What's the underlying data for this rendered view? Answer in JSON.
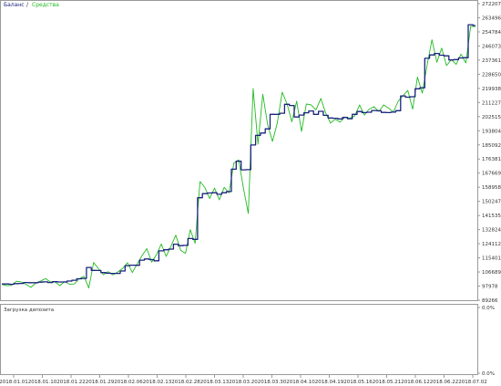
{
  "chart_data": [
    {
      "type": "line",
      "legend": {
        "placement": "top-left",
        "entries": [
          {
            "label": "Баланс",
            "color": "#1a237e"
          },
          {
            "label": "Средства",
            "color": "#22bb22"
          }
        ],
        "separator": " / "
      },
      "y_ticks": [
        "272207",
        "263496",
        "254784",
        "246073",
        "237361",
        "228650",
        "219938",
        "211227",
        "202515",
        "193804",
        "185092",
        "176381",
        "167669",
        "158958",
        "150247",
        "141535",
        "132824",
        "124112",
        "115401",
        "106689",
        "97978",
        "89266"
      ],
      "ylim": [
        89266,
        272207
      ],
      "grid": false,
      "series": [
        {
          "name": "Баланс",
          "color": "#1a237e",
          "values": [
            99300,
            99300,
            99100,
            99500,
            99600,
            100200,
            100100,
            100100,
            100400,
            100600,
            100200,
            100700,
            100500,
            100500,
            101100,
            101600,
            102500,
            102700,
            109500,
            107700,
            107600,
            106300,
            105900,
            105800,
            105800,
            107300,
            110600,
            110900,
            110800,
            114000,
            114700,
            114300,
            113600,
            119700,
            120400,
            120800,
            123800,
            122900,
            123100,
            127300,
            126800,
            152500,
            155000,
            155400,
            155600,
            154600,
            155600,
            156300,
            170100,
            175000,
            169700,
            169800,
            185000,
            190900,
            192400,
            195000,
            203900,
            203900,
            204600,
            210100,
            209400,
            202300,
            203500,
            204900,
            206000,
            203900,
            205800,
            203300,
            201700,
            201500,
            201100,
            202000,
            201200,
            203900,
            205700,
            205000,
            205200,
            206300,
            206100,
            205100,
            205000,
            205300,
            206200,
            215300,
            214500,
            214800,
            219700,
            220300,
            238500,
            240600,
            241500,
            240400,
            240000,
            237500,
            237700,
            238700,
            238900,
            259200,
            258700
          ]
        },
        {
          "name": "Средства",
          "color": "#22bb22",
          "values": [
            99000,
            98200,
            98400,
            101000,
            100600,
            99100,
            97200,
            99700,
            101000,
            102600,
            100700,
            100600,
            98300,
            100800,
            99200,
            99300,
            102500,
            104000,
            96800,
            112500,
            108700,
            105000,
            106900,
            104900,
            106700,
            108900,
            112400,
            106300,
            111600,
            116800,
            121100,
            112800,
            117400,
            124000,
            116300,
            122600,
            129400,
            120100,
            118200,
            132800,
            124400,
            162500,
            158800,
            152000,
            158500,
            151200,
            158900,
            155500,
            173800,
            175900,
            158300,
            142800,
            219900,
            185600,
            216300,
            197700,
            187200,
            198500,
            217600,
            210400,
            199300,
            212100,
            193400,
            210300,
            209800,
            206700,
            213700,
            204800,
            198500,
            200900,
            199200,
            202300,
            201500,
            202800,
            209700,
            203500,
            207200,
            208600,
            205700,
            209700,
            207800,
            205400,
            212000,
            215400,
            218700,
            207100,
            226900,
            217000,
            234300,
            249900,
            236000,
            244800,
            234000,
            237700,
            234700,
            241100,
            235600,
            258200,
            258000
          ]
        }
      ]
    },
    {
      "type": "line",
      "title": "Загрузка депозита",
      "y_ticks": [
        "0.0%",
        "0.0%"
      ],
      "ylim": [
        0,
        0
      ],
      "x_ticks": [
        "2018.01.01",
        "2018.01.10",
        "2018.01.22",
        "2018.01.29",
        "2018.02.06",
        "2018.02.13",
        "2018.02.28",
        "2018.03.13",
        "2018.03.20",
        "2018.03.30",
        "2018.04.10",
        "2018.04.19",
        "2018.05.16",
        "2018.05.21",
        "2018.06.12",
        "2018.06.22",
        "2018.07.02"
      ],
      "series": []
    }
  ],
  "colors": {
    "frame": "#9a9a9a",
    "balance": "#1a237e",
    "equity": "#22bb22",
    "label": "#333333"
  }
}
